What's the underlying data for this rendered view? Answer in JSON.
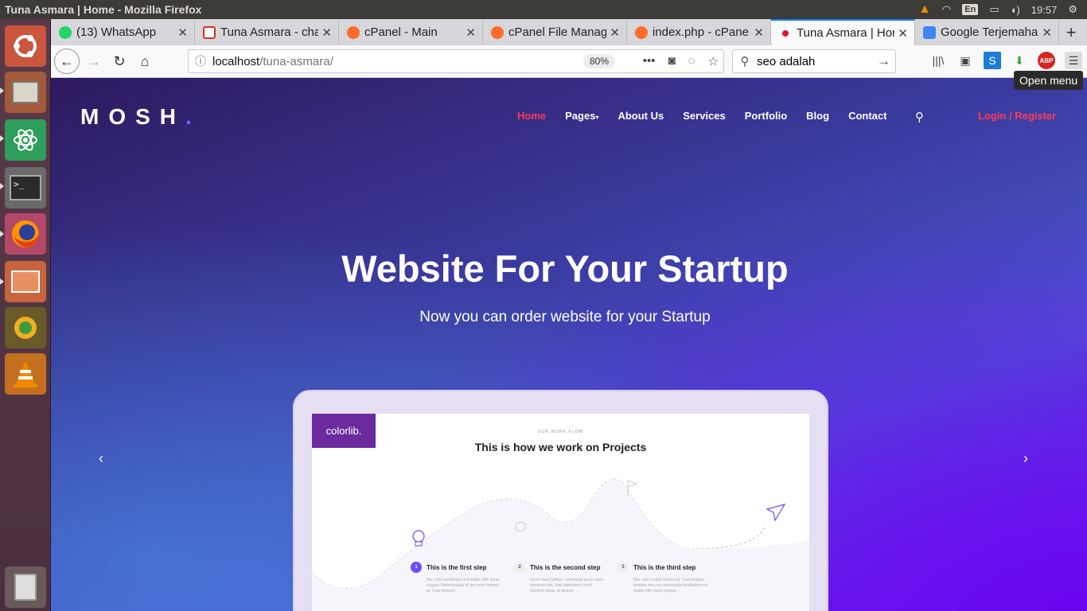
{
  "os": {
    "window_title": "Tuna Asmara | Home - Mozilla Firefox",
    "keyboard": "En",
    "clock": "19:57"
  },
  "launcher": {
    "apps": [
      "ubuntu-logo-icon",
      "files-icon",
      "atom-icon",
      "terminal-icon",
      "firefox-icon",
      "file-manager-icon",
      "lucky-app-icon",
      "vlc-icon",
      "trash-icon"
    ]
  },
  "browser": {
    "tabs": [
      {
        "label": "(13) WhatsApp",
        "icon": "whatsapp-icon",
        "color": "#25d366"
      },
      {
        "label": "Tuna Asmara - cha",
        "icon": "gmail-icon",
        "color": "#d93025"
      },
      {
        "label": "cPanel - Main",
        "icon": "cpanel-icon",
        "color": "#ff6c2c"
      },
      {
        "label": "cPanel File Manag",
        "icon": "cpanel-icon",
        "color": "#ff6c2c"
      },
      {
        "label": "index.php - cPane",
        "icon": "cpanel-icon",
        "color": "#ff6c2c"
      },
      {
        "label": "Tuna Asmara | Hor",
        "icon": "site-icon",
        "color": "#e0143c",
        "active": true
      },
      {
        "label": "Google Terjemaha",
        "icon": "google-translate-icon",
        "color": "#4285f4"
      }
    ],
    "url_host": "localhost",
    "url_path": "/tuna-asmara/",
    "zoom": "80%",
    "search_value": "seo adalah",
    "tooltip": "Open menu"
  },
  "site": {
    "logo": "MOSH",
    "nav": [
      "Home",
      "Pages",
      "About Us",
      "Services",
      "Portfolio",
      "Blog",
      "Contact"
    ],
    "login": "Login / Register",
    "hero_title": "Website For Your Startup",
    "hero_subtitle": "Now you can order website for your Startup",
    "mockup": {
      "brand": "colorlib.",
      "kicker": "OUR WORK FLOW",
      "title": "This is how we work on Projects",
      "steps": [
        {
          "num": "1",
          "label": "This is the first step",
          "desc": "Nec odio vestibulum est mattis effic iturut magna. Pellentesque sit am enim tempor at. Cras tempus."
        },
        {
          "num": "2",
          "label": "This is the second step",
          "desc": "Ut vel risus finibus, consequat ipsum quis, hendrerit nisi. Sed bibendum condi mentum porta, at dictum."
        },
        {
          "num": "3",
          "label": "This is the third step",
          "desc": "Nec odio v estio tempor at. Cras tempus pretium arcu eu malesuada vestibulum est mattis effic iturut magna."
        }
      ]
    }
  }
}
